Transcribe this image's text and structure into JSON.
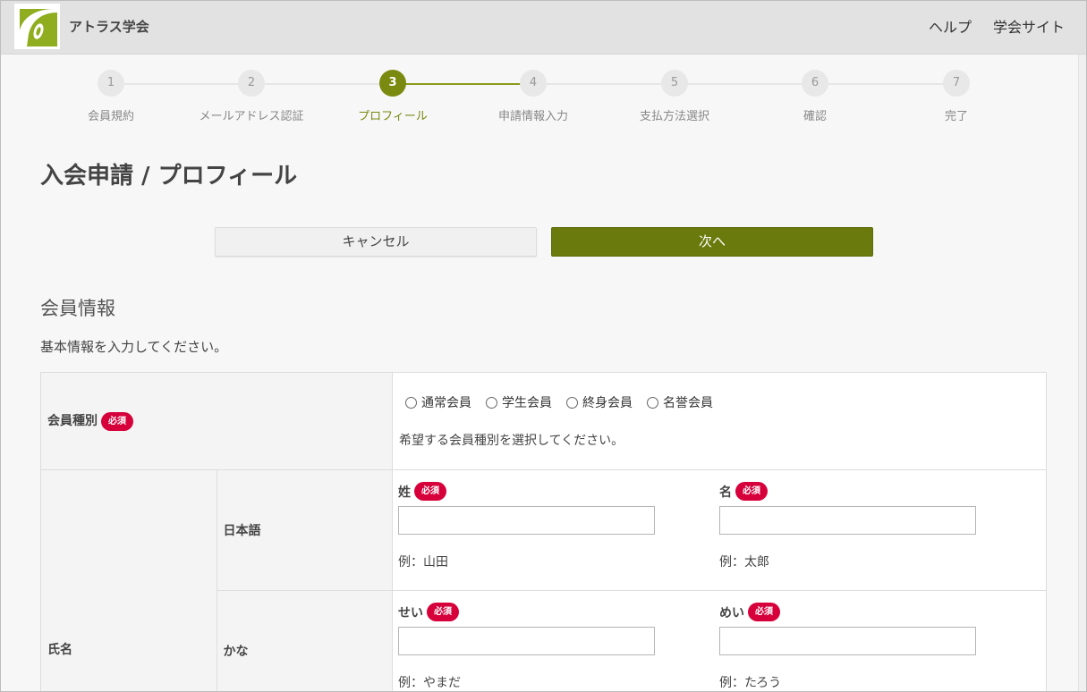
{
  "header": {
    "brand": "アトラス学会",
    "links": [
      "ヘルプ",
      "学会サイト"
    ]
  },
  "stepper": {
    "current": 3,
    "steps": [
      {
        "num": "1",
        "label": "会員規約"
      },
      {
        "num": "2",
        "label": "メールアドレス認証"
      },
      {
        "num": "3",
        "label": "プロフィール"
      },
      {
        "num": "4",
        "label": "申請情報入力"
      },
      {
        "num": "5",
        "label": "支払方法選択"
      },
      {
        "num": "6",
        "label": "確認"
      },
      {
        "num": "7",
        "label": "完了"
      }
    ]
  },
  "page": {
    "title": "入会申請 / プロフィール",
    "cancel_label": "キャンセル",
    "next_label": "次へ",
    "section_title": "会員情報",
    "section_desc": "基本情報を入力してください。"
  },
  "form": {
    "required_badge": "必須",
    "member_type": {
      "label": "会員種別",
      "options": [
        "通常会員",
        "学生会員",
        "終身会員",
        "名誉会員"
      ],
      "hint": "希望する会員種別を選択してください。"
    },
    "name": {
      "label": "氏名",
      "japanese": {
        "label": "日本語",
        "last_label": "姓",
        "last_example": "例：山田",
        "first_label": "名",
        "first_example": "例：太郎"
      },
      "kana": {
        "label": "かな",
        "last_label": "せい",
        "last_example": "例：やまだ",
        "first_label": "めい",
        "first_example": "例：たろう"
      }
    }
  },
  "colors": {
    "accent": "#7a8a10",
    "next_button": "#6b7a0c",
    "required_badge": "#d6003b"
  }
}
